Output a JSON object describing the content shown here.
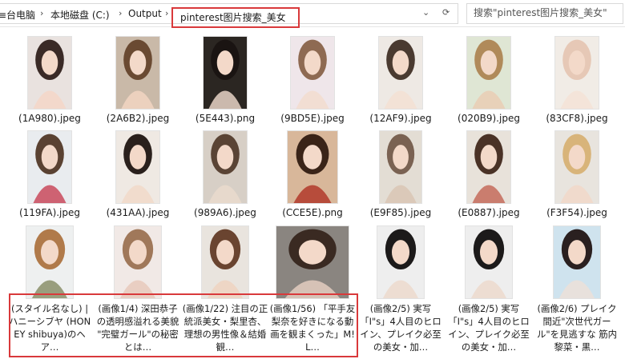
{
  "breadcrumb": {
    "items": [
      "≡台电脑",
      "本地磁盘 (C:)",
      "Output"
    ],
    "current": "pinterest图片搜索_美女",
    "dropdown_icon": "chevron-down-icon",
    "refresh_icon": "refresh-icon"
  },
  "search": {
    "placeholder": "搜索\"pinterest图片搜索_美女\"",
    "icon": "search-icon"
  },
  "colors": {
    "highlight": "#d9393b",
    "border": "#d9d9d9"
  },
  "files": [
    {
      "name": "(1A980).jpeg",
      "c1": "#e9e2df",
      "c2": "#3a2a26",
      "c3": "#f4d6c8"
    },
    {
      "name": "(2A6B2).jpeg",
      "c1": "#c9b9a8",
      "c2": "#6a4a32",
      "c3": "#f2d5c2"
    },
    {
      "name": "(5E443).png",
      "c1": "#2b2622",
      "c2": "#1a1412",
      "c3": "#e8d3c5"
    },
    {
      "name": "(9BD5E).jpeg",
      "c1": "#efe6ea",
      "c2": "#8e6a52",
      "c3": "#f2dccf"
    },
    {
      "name": "(12AF9).jpeg",
      "c1": "#eee9e4",
      "c2": "#4a3a30",
      "c3": "#f3e0d4"
    },
    {
      "name": "(020B9).jpeg",
      "c1": "#dfe6d4",
      "c2": "#b08a5a",
      "c3": "#eacdb4"
    },
    {
      "name": "(83CF8).jpeg",
      "c1": "#f1ece6",
      "c2": "#e6c8b6",
      "c3": "#f5e3d6"
    },
    {
      "name": "(119FA).jpeg",
      "c1": "#e9ecef",
      "c2": "#5a4232",
      "c3": "#c94a5c"
    },
    {
      "name": "(431AA).jpeg",
      "c1": "#efe9e3",
      "c2": "#2a201c",
      "c3": "#f1d9c9"
    },
    {
      "name": "(989A6).jpeg",
      "c1": "#d7cfc6",
      "c2": "#5a4435",
      "c3": "#eadbcc"
    },
    {
      "name": "(CCE5E).png",
      "c1": "#d8b79a",
      "c2": "#3a2418",
      "c3": "#b23a2a"
    },
    {
      "name": "(E9F85).jpeg",
      "c1": "#e3ddd4",
      "c2": "#7a6252",
      "c3": "#d9c6b4"
    },
    {
      "name": "(E0887).jpeg",
      "c1": "#e8e2da",
      "c2": "#4a3226",
      "c3": "#c46b5a"
    },
    {
      "name": "(F3F54).jpeg",
      "c1": "#e8e4de",
      "c2": "#d8b47a",
      "c3": "#f1d8c9"
    }
  ],
  "long_files": [
    {
      "title": "(スタイル名なし) | ハニーシブヤ (HONEY shibuya)のヘア…",
      "c1": "#eef0f0",
      "c2": "#b07a4a",
      "c3": "#8a8f6a"
    },
    {
      "title": "(画像1/4) 深田恭子の透明感溢れる美貌 \"完璧ガール\"の秘密とは…",
      "c1": "#f1e9e6",
      "c2": "#a0785a",
      "c3": "#e7c9bb"
    },
    {
      "title": "(画像1/22) 注目の正統派美女・梨里杏、理想の男性像＆結婚観…",
      "c1": "#e9e4de",
      "c2": "#6a4430",
      "c3": "#efd3c1"
    },
    {
      "title": "(画像1/56) 「平手友梨奈を好きになる動画を観まくった」M!L…",
      "c1": "#8a8580",
      "c2": "#3a2a22",
      "c3": "#e3ccbf"
    },
    {
      "title": "(画像2/5) 実写「I\"s」4人目のヒロイン、プレイク必至の美女・加…",
      "c1": "#eeeeee",
      "c2": "#1c1a1a",
      "c3": "#ecd9cc"
    },
    {
      "title": "(画像2/5) 実写「I\"s」4人目のヒロイン、プレイク必至の美女・加…",
      "c1": "#eeeeee",
      "c2": "#1c1a1a",
      "c3": "#ecd9cc"
    },
    {
      "title": "(画像2/6) プレイク間近\"次世代ガール\"を見逃すな 筋内黎菜・黒…",
      "c1": "#cfe3ee",
      "c2": "#2a2020",
      "c3": "#ece0d8"
    }
  ]
}
